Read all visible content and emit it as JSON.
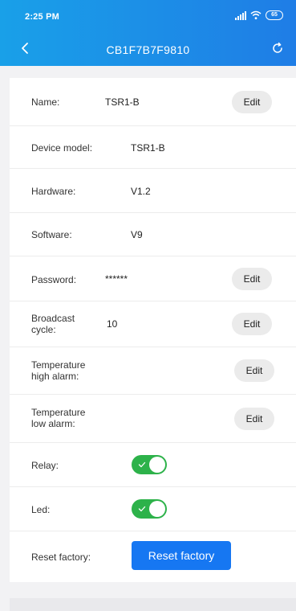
{
  "status_bar": {
    "time": "2:25 PM",
    "battery": "65"
  },
  "nav": {
    "title": "CB1F7B7F9810",
    "icons": [
      "chevron-left-icon",
      "refresh-icon"
    ]
  },
  "rows": {
    "name": {
      "label": "Name:",
      "value": "TSR1-B",
      "action": "Edit"
    },
    "device_model": {
      "label": "Device model:",
      "value": "TSR1-B"
    },
    "hardware": {
      "label": "Hardware:",
      "value": "V1.2"
    },
    "software": {
      "label": "Software:",
      "value": "V9"
    },
    "password": {
      "label": "Password:",
      "value": "******",
      "action": "Edit"
    },
    "broadcast_cycle": {
      "label_line1": "Broadcast",
      "label_line2": "cycle:",
      "value": "10",
      "action": "Edit"
    },
    "temp_high": {
      "label_line1": "Temperature",
      "label_line2": "high alarm:",
      "action": "Edit"
    },
    "temp_low": {
      "label_line1": "Temperature",
      "label_line2": "low alarm:",
      "action": "Edit"
    },
    "relay": {
      "label": "Relay:",
      "enabled": true
    },
    "led": {
      "label": "Led:",
      "enabled": true
    },
    "reset": {
      "label": "Reset factory:",
      "button": "Reset factory"
    }
  },
  "colors": {
    "header_start": "#19a0e8",
    "header_end": "#1f7de6",
    "toggle_on": "#2db24a",
    "primary_button": "#1677f2"
  }
}
